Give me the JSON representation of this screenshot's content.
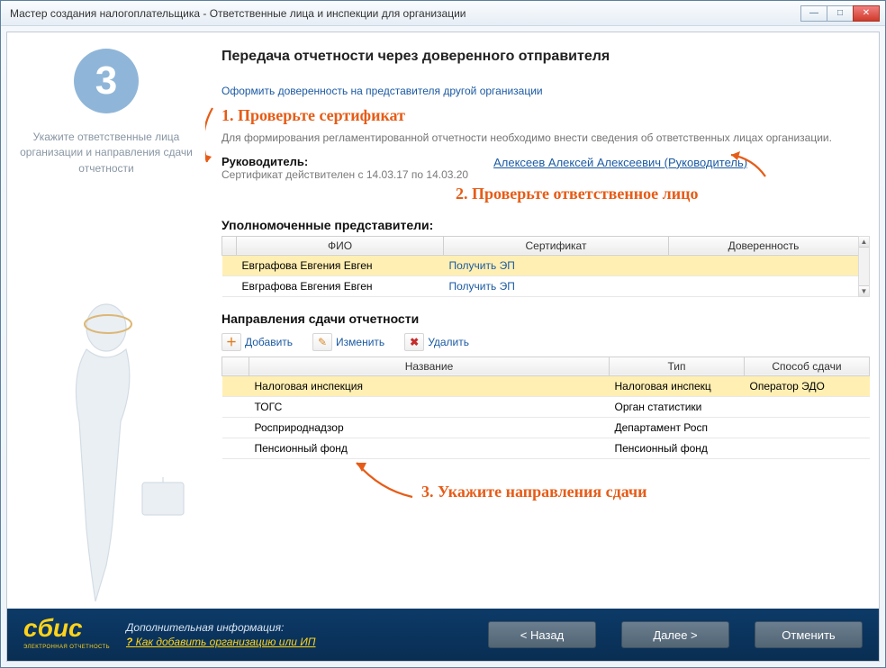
{
  "window": {
    "title": "Мастер создания налогоплательщика - Ответственные лица и инспекции для организации"
  },
  "sidebar": {
    "step": "3",
    "hint": "Укажите ответственные лица организации и направления сдачи отчетности"
  },
  "main": {
    "title": "Передача отчетности через доверенного отправителя",
    "poa_link": "Оформить доверенность на представителя другой организации",
    "info_text": "Для формирования регламентированной отчетности необходимо внести сведения об ответственных лицах организации.",
    "manager_label": "Руководитель:",
    "cert_validity": "Сертификат действителен с 14.03.17 по 14.03.20",
    "manager_name": "Алексеев Алексей Алексеевич (Руководитель)"
  },
  "annotations": {
    "a1": "1. Проверьте сертификат",
    "a2": "2. Проверьте ответственное лицо",
    "a3": "3. Укажите направления сдачи"
  },
  "reps": {
    "heading": "Уполномоченные представители:",
    "cols": {
      "fio": "ФИО",
      "cert": "Сертификат",
      "poa": "Доверенность"
    },
    "rows": [
      {
        "fio": "Евграфова Евгения Евген",
        "cert": "Получить ЭП",
        "poa": ""
      },
      {
        "fio": "Евграфова Евгения Евген",
        "cert": "Получить ЭП",
        "poa": ""
      }
    ]
  },
  "dirs": {
    "heading": "Направления сдачи отчетности",
    "toolbar": {
      "add": "Добавить",
      "edit": "Изменить",
      "del": "Удалить"
    },
    "cols": {
      "name": "Название",
      "type": "Тип",
      "method": "Способ сдачи"
    },
    "rows": [
      {
        "name": "Налоговая инспекция",
        "type": "Налоговая инспекц",
        "method": "Оператор ЭДО"
      },
      {
        "name": "ТОГС",
        "type": "Орган статистики",
        "method": ""
      },
      {
        "name": "Росприроднадзор",
        "type": "Департамент Росп",
        "method": ""
      },
      {
        "name": "Пенсионный фонд",
        "type": "Пенсионный фонд",
        "method": ""
      }
    ]
  },
  "footer": {
    "logo": "сбис",
    "logo_sub": "ЭЛЕКТРОННАЯ ОТЧЕТНОСТЬ",
    "info_label": "Дополнительная информация:",
    "info_q": "Как добавить организацию или ИП",
    "back": "< Назад",
    "next": "Далее >",
    "cancel": "Отменить"
  }
}
